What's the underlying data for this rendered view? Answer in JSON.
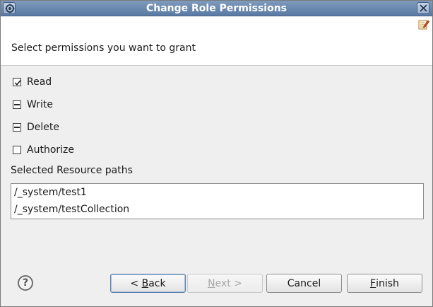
{
  "window": {
    "title": "Change Role Permissions"
  },
  "banner": {
    "message": "Select permissions you want to grant"
  },
  "permissions": [
    {
      "label": "Read",
      "state": "checked"
    },
    {
      "label": "Write",
      "state": "indeterminate"
    },
    {
      "label": "Delete",
      "state": "indeterminate"
    },
    {
      "label": "Authorize",
      "state": "unchecked"
    }
  ],
  "resources": {
    "label": "Selected Resource paths",
    "paths": [
      "/_system/test1",
      "/_system/testCollection"
    ]
  },
  "buttons": {
    "help": "?",
    "back_prefix": "< ",
    "back_mnemonic": "B",
    "back_rest": "ack",
    "next_mnemonic": "N",
    "next_rest": "ext >",
    "cancel": "Cancel",
    "finish_mnemonic": "F",
    "finish_rest": "inish"
  },
  "colors": {
    "titlebar": "#5a7aa3",
    "dialog_bg": "#efefef",
    "focus_border": "#5c7fae"
  }
}
